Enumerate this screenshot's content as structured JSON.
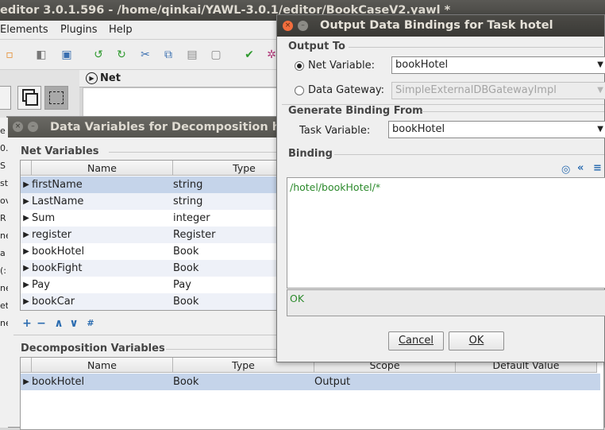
{
  "editor": {
    "title": "editor 3.0.1.596 - /home/qinkai/YAWL-3.0.1/editor/BookCaseV2.yawl *",
    "menus": [
      {
        "label": "Elements",
        "mnemonic": "E",
        "rest": "lements"
      },
      {
        "label": "Plugins",
        "mnemonic": "P",
        "rest": "lugins"
      },
      {
        "label": "Help",
        "mnemonic": "H",
        "rest": "elp"
      }
    ],
    "net_tab": "Net",
    "left_strip": [
      "e",
      "0.",
      "S",
      "st",
      "ov",
      "R",
      "ne",
      "a",
      "(:",
      "ne",
      "et",
      "ne"
    ]
  },
  "toolbar_icons": [
    "new-file-icon",
    "open-icon",
    "save-icon",
    "undo-icon",
    "redo-icon",
    "cut-icon",
    "copy-icon",
    "paste-icon",
    "delete-icon",
    "validate-icon",
    "analyse-icon"
  ],
  "data_variables_dialog": {
    "title": "Data Variables for Decomposition hotel",
    "net_variables_label": "Net Variables",
    "net_columns": [
      "Name",
      "Type"
    ],
    "net_rows": [
      {
        "name": "firstName",
        "type": "string"
      },
      {
        "name": "LastName",
        "type": "string"
      },
      {
        "name": "Sum",
        "type": "integer"
      },
      {
        "name": "register",
        "type": "Register"
      },
      {
        "name": "bookHotel",
        "type": "Book"
      },
      {
        "name": "bookFight",
        "type": "Book"
      },
      {
        "name": "Pay",
        "type": "Pay"
      },
      {
        "name": "bookCar",
        "type": "Book"
      }
    ],
    "net_toolbar": [
      "+",
      "−",
      "∧",
      "∨",
      "#"
    ],
    "decomposition_variables_label": "Decomposition Variables",
    "decomp_columns": [
      "Name",
      "Type",
      "Scope",
      "Default Value"
    ],
    "decomp_rows": [
      {
        "name": "bookHotel",
        "type": "Book",
        "scope": "Output",
        "default": ""
      }
    ]
  },
  "output_bindings_dialog": {
    "title": "Output Data Bindings for Task hotel",
    "output_to_label": "Output To",
    "net_variable_label": "Net Variable:",
    "net_variable_value": "bookHotel",
    "data_gateway_label": "Data Gateway:",
    "data_gateway_value": "SimpleExternalDBGatewayImpl",
    "generate_from_label": "Generate Binding From",
    "task_variable_label": "Task Variable:",
    "task_variable_value": "bookHotel",
    "binding_label": "Binding",
    "binding_text": "/hotel/bookHotel/*",
    "status_text": "OK",
    "cancel_label": "Cancel",
    "ok_label": "OK"
  }
}
